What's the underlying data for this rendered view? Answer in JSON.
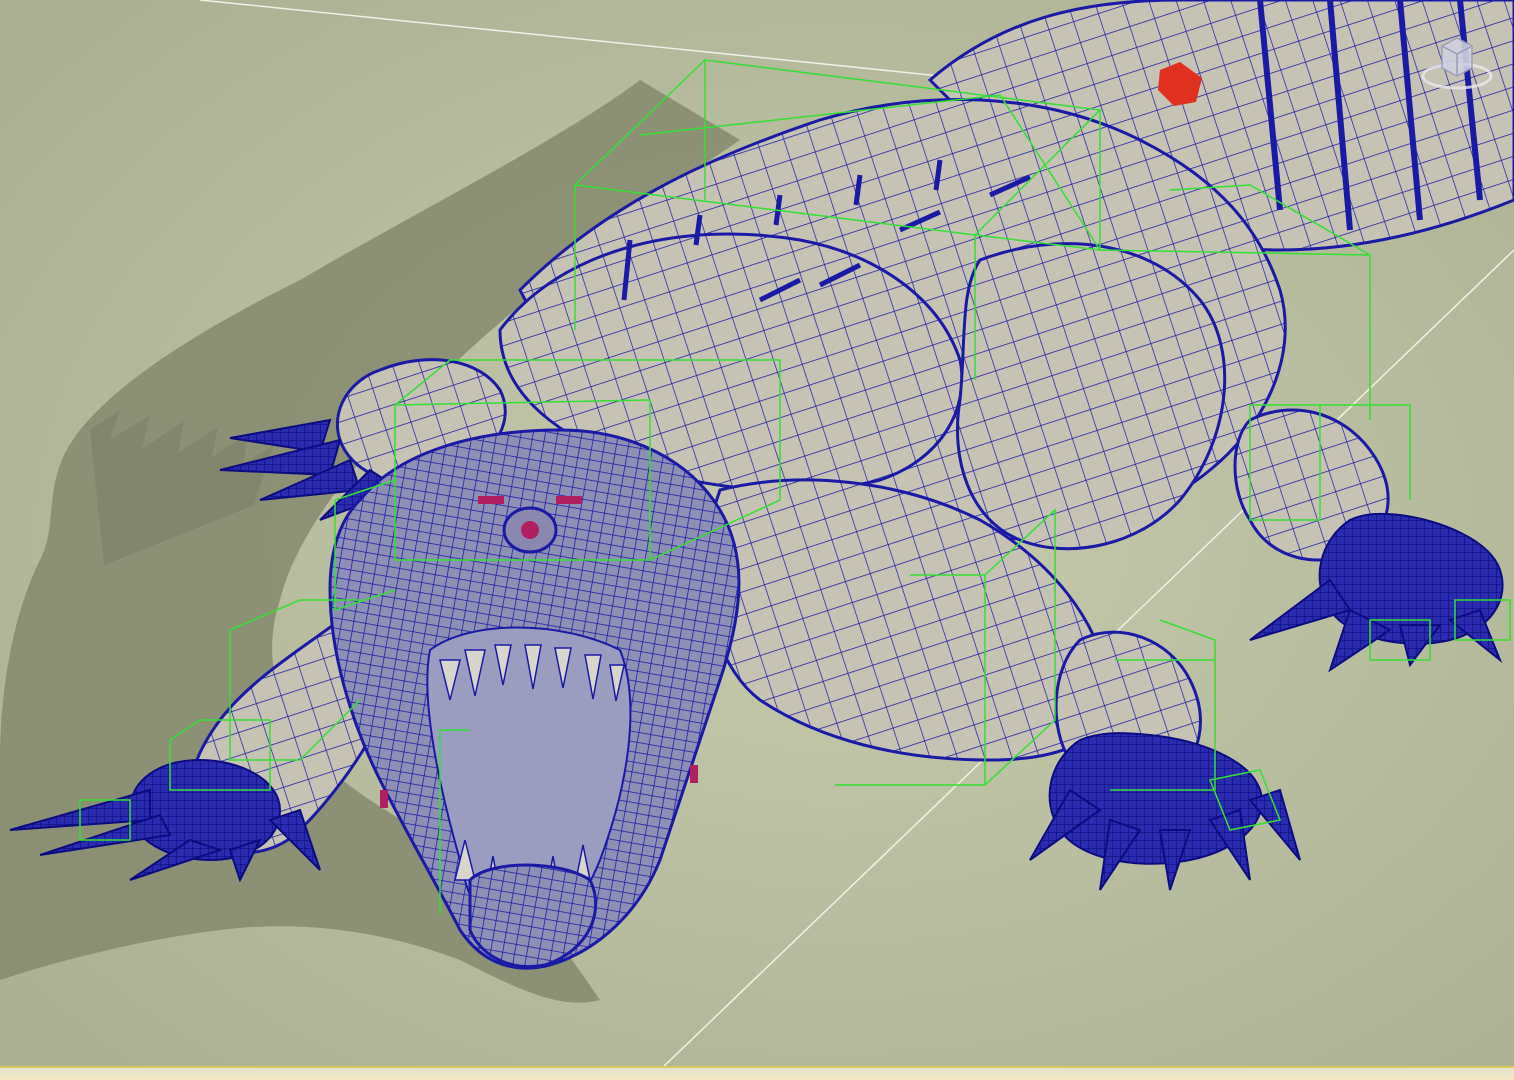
{
  "viewport": {
    "background_color": "#b9bea0",
    "shadow_color": "#858a6f",
    "wireframe_color": "#1a1aa5",
    "bounding_box_color": "#33e033",
    "mesh_fill_color": "#c8c4b6",
    "accent_colors": {
      "eye_lens": "#b02060",
      "back_light": "#e03020"
    }
  },
  "model": {
    "subject": "robotic-crocodile",
    "display_mode": "shaded-with-wireframe"
  },
  "icons": {
    "viewcube": "viewcube-icon"
  }
}
